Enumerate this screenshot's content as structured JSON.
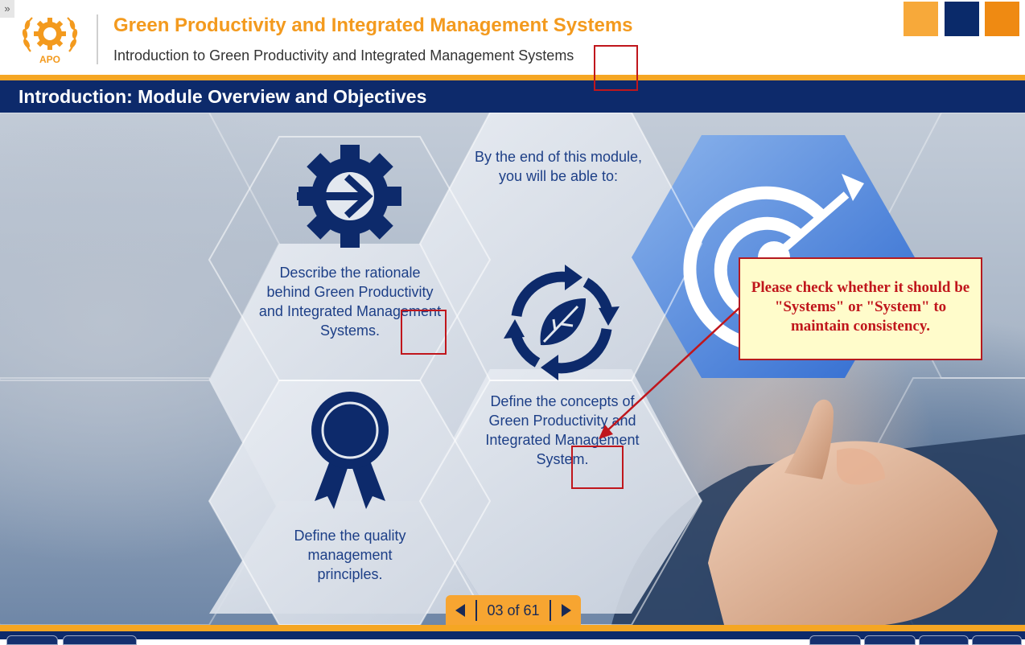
{
  "header": {
    "expand_glyph": "»",
    "course_title": "Green Productivity and Integrated Management Systems",
    "course_subtitle": "Introduction to Green Productivity and Integrated Management Systems",
    "logo_text": "APO"
  },
  "slide": {
    "title": "Introduction: Module Overview and Objectives",
    "intro_text": "By the end of this module, you will be able to:",
    "objectives": [
      {
        "icon": "gear-arrow-icon",
        "text": "Describe the rationale behind Green Productivity and Integrated Management Systems."
      },
      {
        "icon": "leaf-cycle-icon",
        "text": "Define the concepts of Green Productivity and Integrated Management System."
      },
      {
        "icon": "award-ribbon-icon",
        "text": "Define the quality management principles."
      }
    ],
    "target_icon": "target-arrow-icon"
  },
  "review_comment": {
    "text": "Please check whether it should be \"Systems\" or \"System\" to maintain consistency."
  },
  "pager": {
    "label": "03 of 61",
    "current": 3,
    "total": 61
  },
  "colors": {
    "navy": "#0d2a6b",
    "orange": "#f5a623",
    "title_orange": "#f39a1e",
    "hex_text_blue": "#1d3f87",
    "annotation_red": "#c0161c",
    "comment_bg": "#fffccb"
  }
}
